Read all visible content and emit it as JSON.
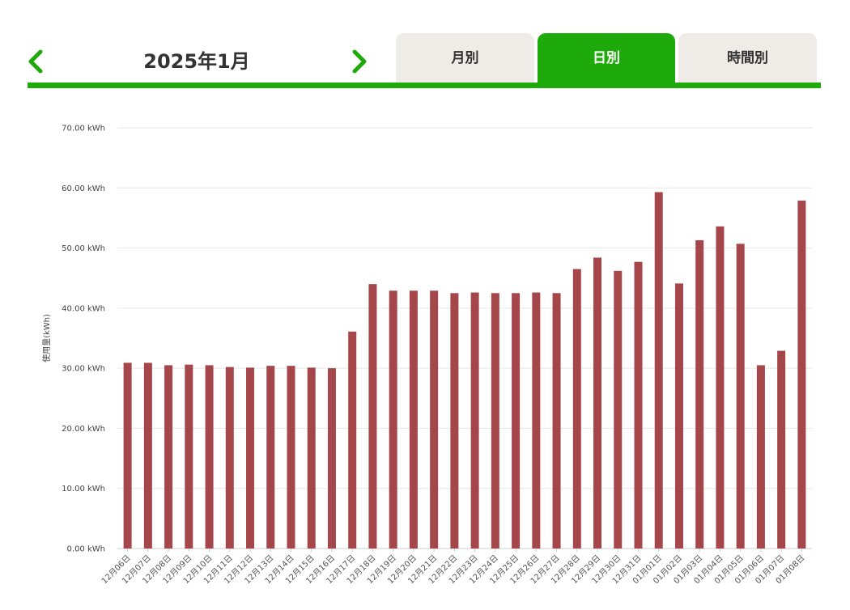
{
  "header": {
    "title": "2025年1月",
    "prev_icon": "chevron-left-icon",
    "next_icon": "chevron-right-icon"
  },
  "tabs": [
    {
      "label": "月別",
      "active": false
    },
    {
      "label": "日別",
      "active": true
    },
    {
      "label": "時間別",
      "active": false
    }
  ],
  "colors": {
    "accent": "#1faa0c",
    "bar": "#a5474a",
    "tab_inactive": "#efebe6"
  },
  "chart_data": {
    "type": "bar",
    "ylabel": "使用量(kWh)",
    "ylim": [
      0,
      70
    ],
    "yticks": [
      0,
      10,
      20,
      30,
      40,
      50,
      60,
      70
    ],
    "ytick_labels": [
      "0.00 kWh",
      "10.00 kWh",
      "20.00 kWh",
      "30.00 kWh",
      "40.00 kWh",
      "50.00 kWh",
      "60.00 kWh",
      "70.00 kWh"
    ],
    "grid": true,
    "categories": [
      "12月06日",
      "12月07日",
      "12月08日",
      "12月09日",
      "12月10日",
      "12月11日",
      "12月12日",
      "12月13日",
      "12月14日",
      "12月15日",
      "12月16日",
      "12月17日",
      "12月18日",
      "12月19日",
      "12月20日",
      "12月21日",
      "12月22日",
      "12月23日",
      "12月24日",
      "12月25日",
      "12月26日",
      "12月27日",
      "12月28日",
      "12月29日",
      "12月30日",
      "12月31日",
      "01月01日",
      "01月02日",
      "01月03日",
      "01月04日",
      "01月05日",
      "01月06日",
      "01月07日",
      "01月08日"
    ],
    "values": [
      30.9,
      30.9,
      30.5,
      30.6,
      30.5,
      30.2,
      30.1,
      30.4,
      30.4,
      30.1,
      30.0,
      36.1,
      44.0,
      42.9,
      42.9,
      42.9,
      42.5,
      42.6,
      42.5,
      42.5,
      42.6,
      42.5,
      46.5,
      48.4,
      46.2,
      47.7,
      59.3,
      44.1,
      51.3,
      53.6,
      50.7,
      30.5,
      32.9,
      57.9
    ]
  }
}
